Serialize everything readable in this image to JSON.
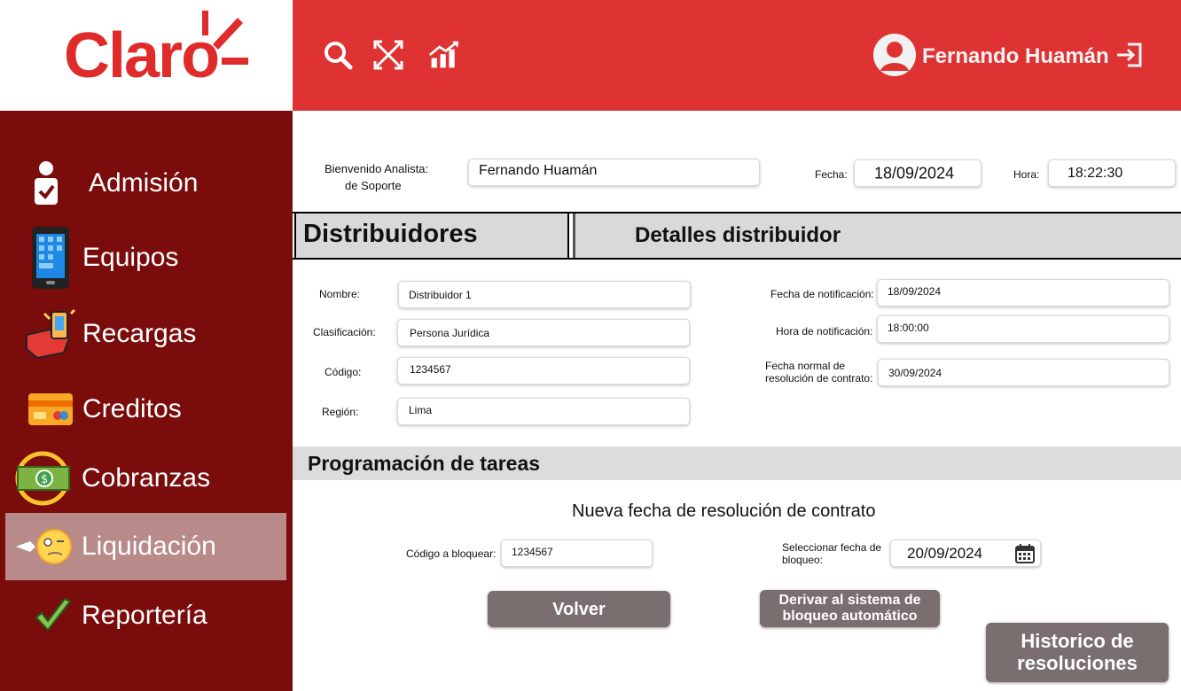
{
  "brand": {
    "logo_text": "Claro",
    "color": "#df3333"
  },
  "header": {
    "icons": [
      "search-icon",
      "crossed-arrows-icon",
      "analytics-icon"
    ],
    "user_name": "Fernando Huamán",
    "logout_icon": "logout-icon"
  },
  "sidebar": {
    "active_color": "#b88a8a",
    "items": [
      {
        "label": "Admisión",
        "icon": "user-check-icon"
      },
      {
        "label": "Equipos",
        "icon": "smartphone-icon"
      },
      {
        "label": "Recargas",
        "icon": "recharge-icon"
      },
      {
        "label": "Creditos",
        "icon": "credit-card-icon"
      },
      {
        "label": "Cobranzas",
        "icon": "money-icon"
      },
      {
        "label": "Liquidación",
        "icon": "liquidation-icon",
        "active": true
      },
      {
        "label": "Reportería",
        "icon": "checkmark-icon"
      }
    ]
  },
  "welcome": {
    "label_line1": "Bienvenido Analista:",
    "label_line2": "de Soporte",
    "name_value": "Fernando Huamán",
    "date_label": "Fecha:",
    "date_value": "18/09/2024",
    "time_label": "Hora:",
    "time_value": "18:22:30"
  },
  "tabs": [
    {
      "label": "Distribuidores"
    },
    {
      "label": "Detalles distribuidor"
    }
  ],
  "details": {
    "nombre_label": "Nombre:",
    "nombre_value": "Distribuidor 1",
    "clasificacion_label": "Clasificación:",
    "clasificacion_value": "Persona Jurídica",
    "codigo_label": "Código:",
    "codigo_value": "1234567",
    "region_label": "Región:",
    "region_value": "Lima",
    "fecha_notif_label": "Fecha de notificación:",
    "fecha_notif_value": "18/09/2024",
    "hora_notif_label": "Hora de notificación:",
    "hora_notif_value": "18:00:00",
    "fecha_normal_label_1": "Fecha normal de",
    "fecha_normal_label_2": "resolución de contrato:",
    "fecha_normal_value": "30/09/2024"
  },
  "tasks": {
    "section_title": "Programación de tareas",
    "subtitle": "Nueva fecha de resolución de contrato",
    "codigo_bloquear_label": "Código a bloquear:",
    "codigo_bloquear_value": "1234567",
    "fecha_bloqueo_label_1": "Seleccionar fecha de",
    "fecha_bloqueo_label_2": "bloqueo:",
    "fecha_bloqueo_value": "20/09/2024"
  },
  "buttons": {
    "volver": "Volver",
    "derivar_1": "Derivar al sistema de",
    "derivar_2": "bloqueo automático",
    "historico_1": "Historico de",
    "historico_2": "resoluciones"
  }
}
